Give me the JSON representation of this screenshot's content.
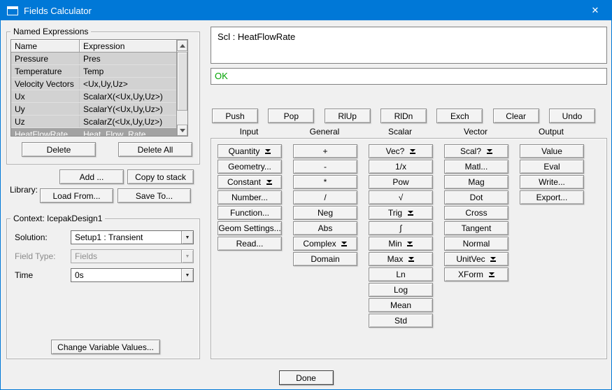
{
  "window": {
    "title": "Fields Calculator"
  },
  "icons": {
    "close": "✕",
    "combo_arrow": "▼"
  },
  "colors": {
    "titlebar": "#0078d7",
    "status_ok": "#00a300",
    "row_selection": "#a2a2a2"
  },
  "named_expressions": {
    "group_label": "Named Expressions",
    "columns": [
      "Name",
      "Expression"
    ],
    "selected_row": "HeatFlowRate",
    "rows": [
      {
        "name": "Pressure",
        "expression": "Pres"
      },
      {
        "name": "Temperature",
        "expression": "Temp"
      },
      {
        "name": "Velocity Vectors",
        "expression": "<Ux,Uy,Uz>"
      },
      {
        "name": "Ux",
        "expression": "ScalarX(<Ux,Uy,Uz>)"
      },
      {
        "name": "Uy",
        "expression": "ScalarY(<Ux,Uy,Uz>)"
      },
      {
        "name": "Uz",
        "expression": "ScalarZ(<Ux,Uy,Uz>)"
      },
      {
        "name": "HeatFlowRate",
        "expression": "Heat_Flow_Rate"
      }
    ],
    "delete_label": "Delete",
    "delete_all_label": "Delete All"
  },
  "library": {
    "label": "Library:",
    "add_label": "Add ...",
    "copy_to_stack_label": "Copy to stack",
    "load_from_label": "Load From...",
    "save_to_label": "Save To..."
  },
  "context": {
    "group_label": "Context: IcepakDesign1",
    "solution_label": "Solution:",
    "solution_value": "Setup1 : Transient",
    "field_type_label": "Field Type:",
    "field_type_value": "Fields",
    "time_label": "Time",
    "time_value": "0s",
    "change_variable_values_label": "Change Variable Values..."
  },
  "stack": {
    "register_display": "Scl : HeatFlowRate",
    "status": "OK"
  },
  "stack_buttons": [
    "Push",
    "Pop",
    "RlUp",
    "RlDn",
    "Exch",
    "Clear",
    "Undo"
  ],
  "calculator": {
    "column_headers": [
      "Input",
      "General",
      "Scalar",
      "Vector",
      "Output"
    ],
    "input": [
      {
        "label": "Quantity",
        "menu": true
      },
      {
        "label": "Geometry...",
        "menu": false
      },
      {
        "label": "Constant",
        "menu": true
      },
      {
        "label": "Number...",
        "menu": false
      },
      {
        "label": "Function...",
        "menu": false
      },
      {
        "label": "Geom Settings...",
        "menu": false
      },
      {
        "label": "Read...",
        "menu": false
      }
    ],
    "general": [
      {
        "label": "+",
        "menu": false
      },
      {
        "label": "-",
        "menu": false
      },
      {
        "label": "*",
        "menu": false
      },
      {
        "label": "/",
        "menu": false
      },
      {
        "label": "Neg",
        "menu": false
      },
      {
        "label": "Abs",
        "menu": false
      },
      {
        "label": "Complex",
        "menu": true
      },
      {
        "label": "Domain",
        "menu": false
      }
    ],
    "scalar": [
      {
        "label": "Vec?",
        "menu": true
      },
      {
        "label": "1/x",
        "menu": false
      },
      {
        "label": "Pow",
        "menu": false
      },
      {
        "label": "√",
        "menu": false
      },
      {
        "label": "Trig",
        "menu": true
      },
      {
        "label": "∫",
        "menu": false
      },
      {
        "label": "Min",
        "menu": true
      },
      {
        "label": "Max",
        "menu": true
      },
      {
        "label": "Ln",
        "menu": false
      },
      {
        "label": "Log",
        "menu": false
      },
      {
        "label": "Mean",
        "menu": false
      },
      {
        "label": "Std",
        "menu": false
      }
    ],
    "vector": [
      {
        "label": "Scal?",
        "menu": true
      },
      {
        "label": "Matl...",
        "menu": false
      },
      {
        "label": "Mag",
        "menu": false
      },
      {
        "label": "Dot",
        "menu": false
      },
      {
        "label": "Cross",
        "menu": false
      },
      {
        "label": "Tangent",
        "menu": false
      },
      {
        "label": "Normal",
        "menu": false
      },
      {
        "label": "UnitVec",
        "menu": true
      },
      {
        "label": "XForm",
        "menu": true
      }
    ],
    "output": [
      {
        "label": "Value",
        "menu": false
      },
      {
        "label": "Eval",
        "menu": false
      },
      {
        "label": "Write...",
        "menu": false
      },
      {
        "label": "Export...",
        "menu": false
      }
    ]
  },
  "done_label": "Done"
}
